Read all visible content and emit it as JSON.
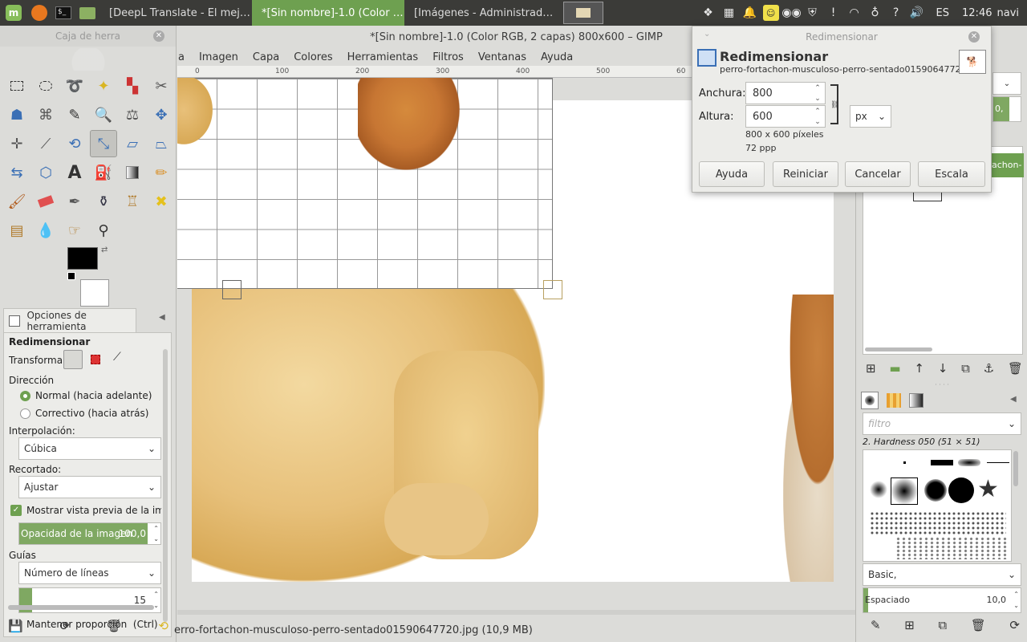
{
  "taskbar": {
    "tasks": [
      {
        "label": "[DeepL Translate - El mej…",
        "active": false
      },
      {
        "label": "*[Sin nombre]-1.0 (Color …",
        "active": true
      },
      {
        "label": "[Imágenes - Administrad…",
        "active": false
      }
    ],
    "keyboard_layout": "ES",
    "clock": "12:46",
    "user": "navi"
  },
  "toolbox": {
    "title": "Caja de herra",
    "tool_options_tab": "Opciones de herramienta",
    "tool_name": "Redimensionar",
    "transform_label": "Transformar:",
    "direction_label": "Dirección",
    "direction_options": [
      "Normal (hacia adelante)",
      "Correctivo (hacia atrás)"
    ],
    "interpolation_label": "Interpolación:",
    "interpolation_value": "Cúbica",
    "clipping_label": "Recortado:",
    "clipping_value": "Ajustar",
    "show_preview_label": "Mostrar vista previa de la imagen",
    "opacity_label": "Opacidad de la imagen",
    "opacity_value": "100,0",
    "guides_label": "Guías",
    "guides_value": "Número de líneas",
    "lines_value": "15",
    "keep_aspect_label": "Mantener proporción  (Ctrl)"
  },
  "main": {
    "title": "*[Sin nombre]-1.0 (Color RGB, 2 capas) 800x600 – GIMP",
    "menu": [
      "a",
      "Imagen",
      "Capa",
      "Colores",
      "Herramientas",
      "Filtros",
      "Ventanas",
      "Ayuda"
    ],
    "ruler_ticks": [
      "0",
      "100",
      "200",
      "300",
      "400",
      "500",
      "60"
    ],
    "status": "erro-fortachon-musculoso-perro-sentado01590647720.jpg (10,9 MB)"
  },
  "dialog": {
    "window_title": "Redimensionar",
    "header": "Redimensionar",
    "subtitle": "perro-fortachon-musculoso-perro-sentado01590647720…",
    "width_label": "Anchura:",
    "width_value": "800",
    "height_label": "Altura:",
    "height_value": "600",
    "unit": "px",
    "size_info": "800 x 600 píxeles",
    "resolution": "72 ppp",
    "buttons": {
      "help": "Ayuda",
      "reset": "Reiniciar",
      "cancel": "Cancelar",
      "scale": "Escala"
    }
  },
  "rightdock": {
    "layer_fragment": "achon-",
    "spin_fragment": "0,",
    "brush_filter_placeholder": "filtro",
    "brush_name": "2. Hardness 050 (51 × 51)",
    "brush_tag": "Basic,",
    "spacing_label": "Espaciado",
    "spacing_value": "10,0"
  },
  "colors": {
    "accent": "#6ea050",
    "panel_bg": "#dcdcd9",
    "topbar": "#3b3b38"
  }
}
